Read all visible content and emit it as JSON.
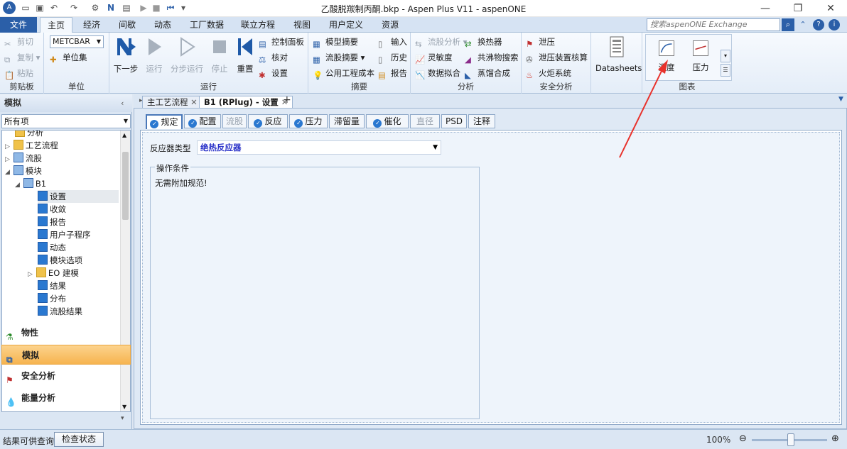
{
  "window": {
    "title": "乙酸脱羰制丙酮.bkp - Aspen Plus V11 - aspenONE",
    "controls": [
      "minimize",
      "restore",
      "close"
    ]
  },
  "menubar": {
    "items": [
      "文件",
      "主页",
      "经济",
      "间歇",
      "动态",
      "工厂数据",
      "联立方程",
      "视图",
      "用户定义",
      "资源"
    ],
    "search_placeholder": "搜索aspenONE Exchange"
  },
  "ribbon": {
    "clipboard": {
      "label": "剪贴板",
      "cut": "剪切",
      "copy": "复制",
      "paste": "粘贴"
    },
    "units": {
      "label": "单位",
      "unit_set": "METCBAR",
      "unit_sets": "单位集"
    },
    "run": {
      "label": "运行",
      "next": "下一步",
      "run": "运行",
      "step": "分步运行",
      "stop": "停止",
      "reset": "重置",
      "control_panel": "控制面板",
      "reconcile": "核对",
      "settings": "设置"
    },
    "summary": {
      "label": "摘要",
      "model_summary": "模型摘要",
      "stream_summary": "流股摘要",
      "utility_costs": "公用工程成本",
      "input": "输入",
      "history": "历史",
      "report": "报告"
    },
    "analysis": {
      "label": "分析",
      "stream_analysis": "流股分析",
      "sensitivity": "灵敏度",
      "data_fit": "数据拟合",
      "heat_exchanger": "换热器",
      "azeotrope_search": "共沸物搜索",
      "distillation_synthesis": "蒸馏合成"
    },
    "safety": {
      "label": "安全分析",
      "pressure_relief": "泄压",
      "relief_rating": "泄压装置核算",
      "flare_system": "火炬系统"
    },
    "datasheets": {
      "label": "Datasheets"
    },
    "plots": {
      "label": "图表",
      "temperature": "温度",
      "pressure": "压力"
    }
  },
  "nav": {
    "title": "模拟",
    "filter": "所有项",
    "tree": [
      {
        "label": "分析",
        "level": 1
      },
      {
        "label": "工艺流程",
        "level": 1
      },
      {
        "label": "流股",
        "level": 1
      },
      {
        "label": "模块",
        "level": 1
      },
      {
        "label": "B1",
        "level": 2
      },
      {
        "label": "设置",
        "level": 3
      },
      {
        "label": "收敛",
        "level": 3
      },
      {
        "label": "报告",
        "level": 3
      },
      {
        "label": "用户子程序",
        "level": 3
      },
      {
        "label": "动态",
        "level": 3
      },
      {
        "label": "模块选项",
        "level": 3
      },
      {
        "label": "EO 建模",
        "level": 3
      },
      {
        "label": "结果",
        "level": 3
      },
      {
        "label": "分布",
        "level": 3
      },
      {
        "label": "流股结果",
        "level": 3
      }
    ],
    "sections": [
      "物性",
      "模拟",
      "安全分析",
      "能量分析"
    ],
    "selected_section": "模拟"
  },
  "doc_tabs": [
    "主工艺流程",
    "B1 (RPlug) - 设置"
  ],
  "form_tabs": [
    {
      "label": "规定",
      "check": true
    },
    {
      "label": "配置",
      "check": true
    },
    {
      "label": "流股",
      "check": false
    },
    {
      "label": "反应",
      "check": true
    },
    {
      "label": "压力",
      "check": true
    },
    {
      "label": "滞留量",
      "check": false
    },
    {
      "label": "催化剂",
      "check": true
    },
    {
      "label": "直径",
      "check": false
    },
    {
      "label": "PSD",
      "check": false
    },
    {
      "label": "注释",
      "check": false
    }
  ],
  "form": {
    "reactor_type_label": "反应器类型",
    "reactor_type_value": "绝热反应器",
    "op_conditions_title": "操作条件",
    "op_conditions_msg": "无需附加规范!"
  },
  "status": {
    "text": "结果可供查询",
    "check_status": "检查状态",
    "zoom": "100%"
  },
  "colors": {
    "accent": "#2b5fa8",
    "annotation": "#e8322c",
    "selected_nav": "#f6b44f"
  }
}
